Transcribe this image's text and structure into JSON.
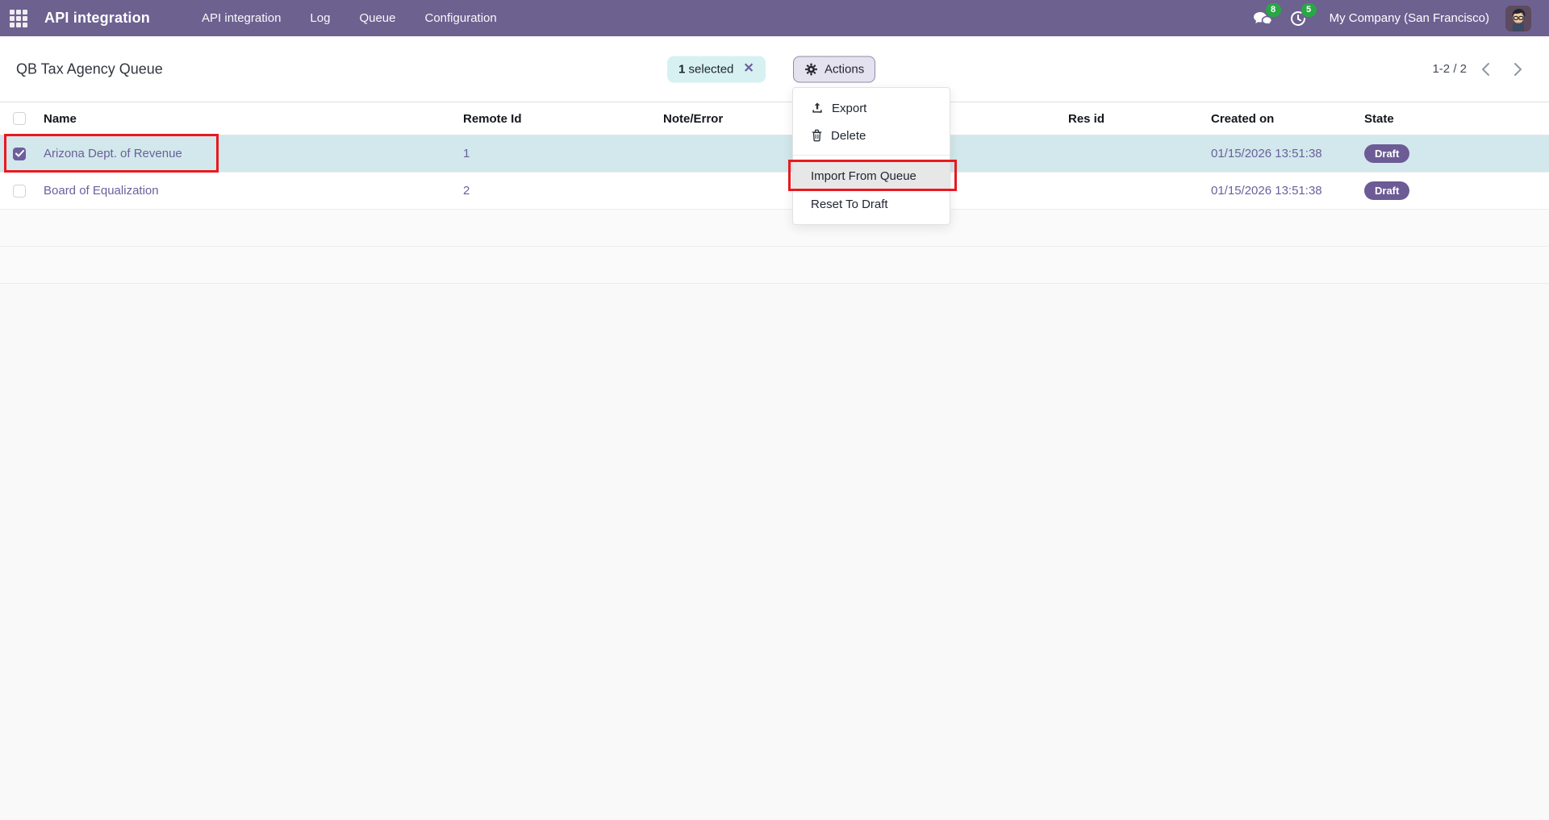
{
  "topbar": {
    "app_name": "API integration",
    "menu": [
      {
        "label": "API integration"
      },
      {
        "label": "Log"
      },
      {
        "label": "Queue"
      },
      {
        "label": "Configuration"
      }
    ],
    "messages_count": "8",
    "activities_count": "5",
    "company": "My Company (San Francisco)"
  },
  "control_panel": {
    "title": "QB Tax Agency Queue",
    "selection": {
      "count": "1",
      "label": "selected",
      "close_glyph": "✕"
    },
    "actions_label": "Actions",
    "pager": {
      "range": "1-2 / 2"
    }
  },
  "dropdown": {
    "items": [
      {
        "label": "Export",
        "icon": "upload-icon"
      },
      {
        "label": "Delete",
        "icon": "trash-icon"
      },
      {
        "label": "Import From Queue",
        "highlighted": true
      },
      {
        "label": "Reset To Draft"
      }
    ]
  },
  "table": {
    "columns": [
      "Name",
      "Remote Id",
      "Note/Error",
      "Res id",
      "Created on",
      "State"
    ],
    "rows": [
      {
        "name": "Arizona Dept. of Revenue",
        "remote_id": "1",
        "note_error": "",
        "res_id": "",
        "created_on": "01/15/2026 13:51:38",
        "state": "Draft",
        "selected": true
      },
      {
        "name": "Board of Equalization",
        "remote_id": "2",
        "note_error": "",
        "res_id": "",
        "created_on": "01/15/2026 13:51:38",
        "state": "Draft",
        "selected": false
      }
    ]
  },
  "icons": {
    "apps": "grid-icon",
    "messages": "chat-bubbles-icon",
    "activities": "clock-icon",
    "actions": "gear-icon",
    "export": "upload-icon",
    "delete": "trash-icon",
    "pager_prev": "chevron-left-icon",
    "pager_next": "chevron-right-icon"
  },
  "colors": {
    "topbar": "#6d6190",
    "accent_purple": "#6b5f9b",
    "selected_row": "#d2e8ec",
    "selection_pill": "#d7f1f2",
    "badge_green": "#28a745",
    "state_badge": "#6c5b95",
    "annotation_red": "#e8191f",
    "actions_button": "#e5e2ef"
  }
}
